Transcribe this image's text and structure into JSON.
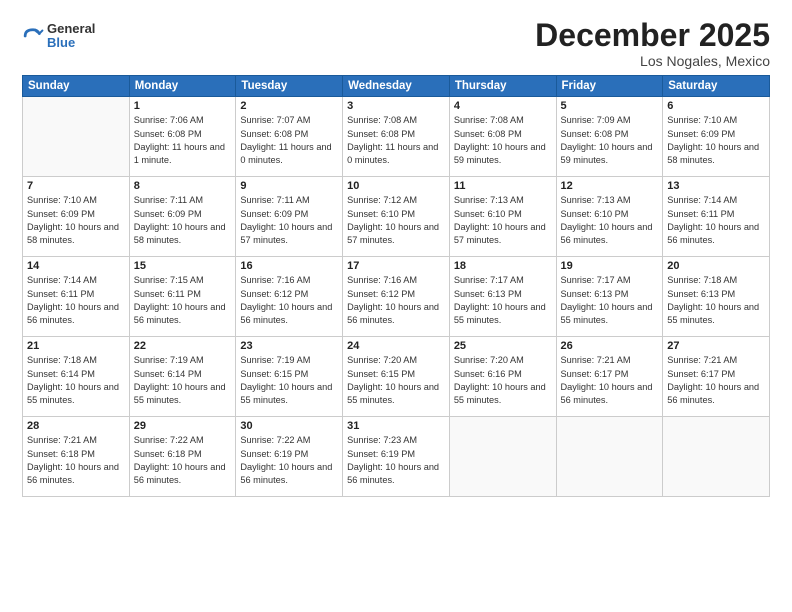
{
  "logo": {
    "general": "General",
    "blue": "Blue"
  },
  "title": "December 2025",
  "location": "Los Nogales, Mexico",
  "days_of_week": [
    "Sunday",
    "Monday",
    "Tuesday",
    "Wednesday",
    "Thursday",
    "Friday",
    "Saturday"
  ],
  "weeks": [
    [
      {
        "day": "",
        "empty": true
      },
      {
        "day": "1",
        "sunrise": "7:06 AM",
        "sunset": "6:08 PM",
        "daylight": "11 hours and 1 minute."
      },
      {
        "day": "2",
        "sunrise": "7:07 AM",
        "sunset": "6:08 PM",
        "daylight": "11 hours and 0 minutes."
      },
      {
        "day": "3",
        "sunrise": "7:08 AM",
        "sunset": "6:08 PM",
        "daylight": "11 hours and 0 minutes."
      },
      {
        "day": "4",
        "sunrise": "7:08 AM",
        "sunset": "6:08 PM",
        "daylight": "10 hours and 59 minutes."
      },
      {
        "day": "5",
        "sunrise": "7:09 AM",
        "sunset": "6:08 PM",
        "daylight": "10 hours and 59 minutes."
      },
      {
        "day": "6",
        "sunrise": "7:10 AM",
        "sunset": "6:09 PM",
        "daylight": "10 hours and 58 minutes."
      }
    ],
    [
      {
        "day": "7",
        "sunrise": "7:10 AM",
        "sunset": "6:09 PM",
        "daylight": "10 hours and 58 minutes."
      },
      {
        "day": "8",
        "sunrise": "7:11 AM",
        "sunset": "6:09 PM",
        "daylight": "10 hours and 58 minutes."
      },
      {
        "day": "9",
        "sunrise": "7:11 AM",
        "sunset": "6:09 PM",
        "daylight": "10 hours and 57 minutes."
      },
      {
        "day": "10",
        "sunrise": "7:12 AM",
        "sunset": "6:10 PM",
        "daylight": "10 hours and 57 minutes."
      },
      {
        "day": "11",
        "sunrise": "7:13 AM",
        "sunset": "6:10 PM",
        "daylight": "10 hours and 57 minutes."
      },
      {
        "day": "12",
        "sunrise": "7:13 AM",
        "sunset": "6:10 PM",
        "daylight": "10 hours and 56 minutes."
      },
      {
        "day": "13",
        "sunrise": "7:14 AM",
        "sunset": "6:11 PM",
        "daylight": "10 hours and 56 minutes."
      }
    ],
    [
      {
        "day": "14",
        "sunrise": "7:14 AM",
        "sunset": "6:11 PM",
        "daylight": "10 hours and 56 minutes."
      },
      {
        "day": "15",
        "sunrise": "7:15 AM",
        "sunset": "6:11 PM",
        "daylight": "10 hours and 56 minutes."
      },
      {
        "day": "16",
        "sunrise": "7:16 AM",
        "sunset": "6:12 PM",
        "daylight": "10 hours and 56 minutes."
      },
      {
        "day": "17",
        "sunrise": "7:16 AM",
        "sunset": "6:12 PM",
        "daylight": "10 hours and 56 minutes."
      },
      {
        "day": "18",
        "sunrise": "7:17 AM",
        "sunset": "6:13 PM",
        "daylight": "10 hours and 55 minutes."
      },
      {
        "day": "19",
        "sunrise": "7:17 AM",
        "sunset": "6:13 PM",
        "daylight": "10 hours and 55 minutes."
      },
      {
        "day": "20",
        "sunrise": "7:18 AM",
        "sunset": "6:13 PM",
        "daylight": "10 hours and 55 minutes."
      }
    ],
    [
      {
        "day": "21",
        "sunrise": "7:18 AM",
        "sunset": "6:14 PM",
        "daylight": "10 hours and 55 minutes."
      },
      {
        "day": "22",
        "sunrise": "7:19 AM",
        "sunset": "6:14 PM",
        "daylight": "10 hours and 55 minutes."
      },
      {
        "day": "23",
        "sunrise": "7:19 AM",
        "sunset": "6:15 PM",
        "daylight": "10 hours and 55 minutes."
      },
      {
        "day": "24",
        "sunrise": "7:20 AM",
        "sunset": "6:15 PM",
        "daylight": "10 hours and 55 minutes."
      },
      {
        "day": "25",
        "sunrise": "7:20 AM",
        "sunset": "6:16 PM",
        "daylight": "10 hours and 55 minutes."
      },
      {
        "day": "26",
        "sunrise": "7:21 AM",
        "sunset": "6:17 PM",
        "daylight": "10 hours and 56 minutes."
      },
      {
        "day": "27",
        "sunrise": "7:21 AM",
        "sunset": "6:17 PM",
        "daylight": "10 hours and 56 minutes."
      }
    ],
    [
      {
        "day": "28",
        "sunrise": "7:21 AM",
        "sunset": "6:18 PM",
        "daylight": "10 hours and 56 minutes."
      },
      {
        "day": "29",
        "sunrise": "7:22 AM",
        "sunset": "6:18 PM",
        "daylight": "10 hours and 56 minutes."
      },
      {
        "day": "30",
        "sunrise": "7:22 AM",
        "sunset": "6:19 PM",
        "daylight": "10 hours and 56 minutes."
      },
      {
        "day": "31",
        "sunrise": "7:23 AM",
        "sunset": "6:19 PM",
        "daylight": "10 hours and 56 minutes."
      },
      {
        "day": "",
        "empty": true
      },
      {
        "day": "",
        "empty": true
      },
      {
        "day": "",
        "empty": true
      }
    ]
  ]
}
